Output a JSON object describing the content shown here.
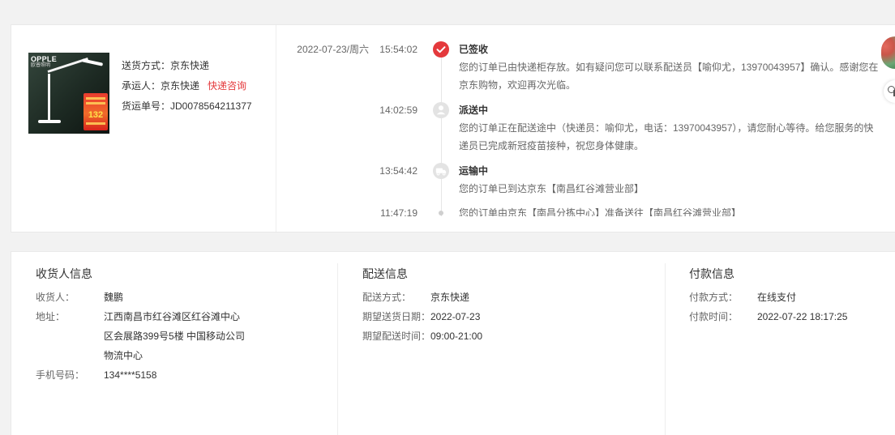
{
  "page": {
    "background_color": "#f2f2f2",
    "accent_color": "#e4393c"
  },
  "shipment": {
    "product_image": {
      "logo": "OPPLE",
      "logo_sub": "欧普照明",
      "price_badge": "132"
    },
    "method": {
      "label": "送货方式：",
      "value": "京东快递"
    },
    "carrier": {
      "label": "承运人：",
      "value": "京东快递",
      "link": "快递咨询"
    },
    "tracking": {
      "label": "货运单号：",
      "value": "JD0078564211377"
    }
  },
  "timeline": [
    {
      "date": "2022-07-23/周六",
      "time": "15:54:02",
      "status": "已签收",
      "icon": "check-circle-icon",
      "detail": "您的订单已由快递柜存放。如有疑问您可以联系配送员【喻仰尤，13970043957】确认。感谢您在京东购物，欢迎再次光临。"
    },
    {
      "time": "14:02:59",
      "status": "派送中",
      "icon": "courier-icon",
      "detail": "您的订单正在配送途中（快递员：喻仰尤，电话：13970043957），请您耐心等待。给您服务的快递员已完成新冠疫苗接种，祝您身体健康。"
    },
    {
      "time": "13:54:42",
      "status": "运输中",
      "icon": "truck-icon",
      "detail": "您的订单已到达京东【南昌红谷滩营业部】"
    },
    {
      "time": "11:47:19",
      "icon": "dot-icon",
      "detail": "您的订单由京东【南昌分拣中心】准备送往【南昌红谷滩营业部】"
    }
  ],
  "side_widgets": {
    "avatar_icon": "user-avatar-icon",
    "service_icon": "customer-service-icon"
  },
  "info": {
    "consignee": {
      "heading": "收货人信息",
      "name": {
        "label": "收货人：",
        "value": "魏鹏"
      },
      "address": {
        "label": "地址：",
        "value": "江西南昌市红谷滩区红谷滩中心区会展路399号5楼 中国移动公司物流中心"
      },
      "phone": {
        "label": "手机号码：",
        "value": "134****5158"
      }
    },
    "delivery": {
      "heading": "配送信息",
      "method": {
        "label": "配送方式：",
        "value": "京东快递"
      },
      "date": {
        "label": "期望送货日期：",
        "value": "2022-07-23"
      },
      "time": {
        "label": "期望配送时间：",
        "value": "09:00-21:00"
      }
    },
    "payment": {
      "heading": "付款信息",
      "method": {
        "label": "付款方式：",
        "value": "在线支付"
      },
      "time": {
        "label": "付款时间：",
        "value": "2022-07-22 18:17:25"
      }
    }
  }
}
